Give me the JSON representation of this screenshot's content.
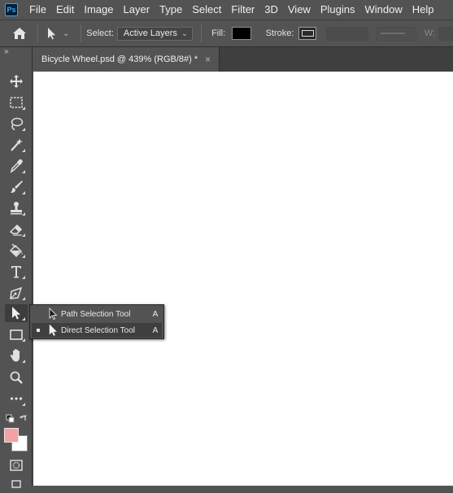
{
  "app": {
    "logo_text": "Ps"
  },
  "menubar": {
    "items": [
      "File",
      "Edit",
      "Image",
      "Layer",
      "Type",
      "Select",
      "Filter",
      "3D",
      "View",
      "Plugins",
      "Window",
      "Help"
    ]
  },
  "options": {
    "select_label": "Select:",
    "select_value": "Active Layers",
    "fill_label": "Fill:",
    "fill_color": "#000000",
    "stroke_label": "Stroke:",
    "w_label": "W:"
  },
  "document": {
    "tab_title": "Bicycle Wheel.psd @ 439% (RGB/8#) *",
    "close_glyph": "×"
  },
  "toolbar": {
    "collapse_glyph": "»",
    "foreground_color": "#f4a0a4",
    "background_color": "#ffffff",
    "tools": [
      "move-icon",
      "marquee-icon",
      "lasso-icon",
      "magic-wand-icon",
      "eyedropper-icon",
      "brush-icon",
      "clone-stamp-icon",
      "eraser-icon",
      "paint-bucket-icon",
      "type-icon",
      "pen-icon",
      "path-selection-icon",
      "rectangle-icon",
      "hand-icon",
      "zoom-icon",
      "more-tools-icon",
      "quick-mask-icon",
      "screen-mode-icon"
    ]
  },
  "flyout": {
    "items": [
      {
        "label": "Path Selection Tool",
        "shortcut": "A"
      },
      {
        "label": "Direct Selection Tool",
        "shortcut": "A"
      }
    ]
  }
}
